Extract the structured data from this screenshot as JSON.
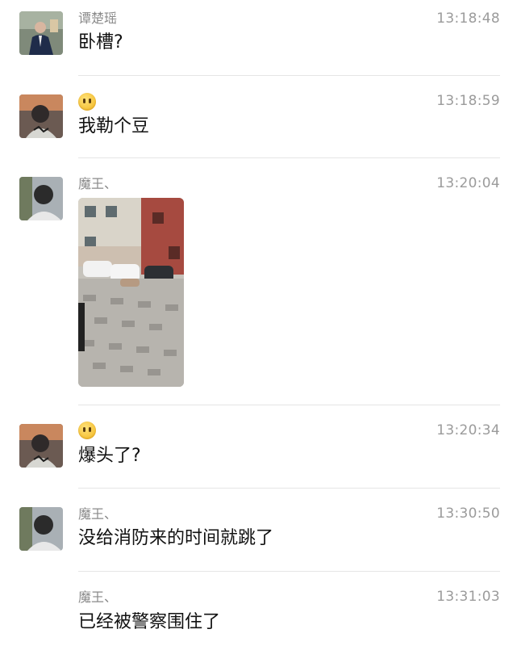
{
  "messages": [
    {
      "sender": "谭楚瑶",
      "time": "13:18:48",
      "text": "卧槽?"
    },
    {
      "sender": "",
      "sender_icon": "neutral-face-emoji",
      "time": "13:18:59",
      "text": "我勒个豆"
    },
    {
      "sender": "魔王、",
      "time": "13:20:04",
      "text": "",
      "attachment": "street-photo"
    },
    {
      "sender": "",
      "sender_icon": "neutral-face-emoji",
      "time": "13:20:34",
      "text": "爆头了?"
    },
    {
      "sender": "魔王、",
      "time": "13:30:50",
      "text": "没给消防来的时间就跳了"
    },
    {
      "sender": "魔王、",
      "time": "13:31:03",
      "text": "已经被警察围住了"
    }
  ],
  "colors": {
    "sender": "#8a8a8a",
    "time": "#9b9b9b",
    "text": "#111111",
    "divider": "#e5e5e5"
  }
}
